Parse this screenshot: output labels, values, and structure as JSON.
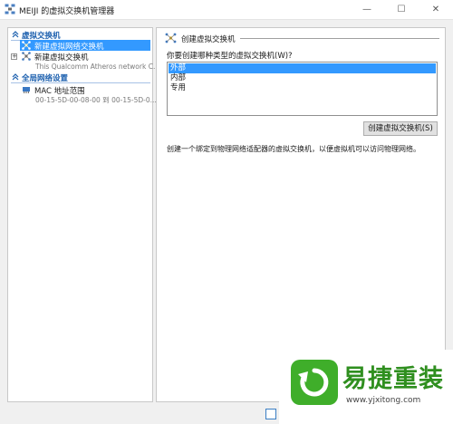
{
  "window": {
    "title": "MEIJI 的虚拟交换机管理器",
    "minimize_glyph": "—",
    "maximize_glyph": "☐",
    "close_glyph": "✕"
  },
  "left_pane": {
    "sections": [
      {
        "label": "虚拟交换机"
      },
      {
        "label": "全局网络设置"
      }
    ],
    "items": [
      {
        "label": "新建虚拟网络交换机",
        "selected": true
      },
      {
        "label": "新建虚拟交换机",
        "sub": "This Qualcomm Atheros network C...",
        "expander": "+"
      },
      {
        "label": "MAC 地址范围",
        "sub": "00-15-5D-00-08-00 到 00-15-5D-0..."
      }
    ]
  },
  "right_pane": {
    "title": "创建虚拟交换机",
    "prompt": "你要创建哪种类型的虚拟交换机(W)?",
    "switch_types": [
      {
        "label": "外部",
        "selected": true
      },
      {
        "label": "内部",
        "selected": false
      },
      {
        "label": "专用",
        "selected": false
      }
    ],
    "create_button": "创建虚拟交换机(S)",
    "description": "创建一个绑定到物理网络适配器的虚拟交换机，以便虚拟机可以访问物理网络。"
  },
  "watermark": {
    "name": "易捷重装",
    "url": "www.yjxitong.com"
  },
  "colors": {
    "selection": "#3399ff",
    "section_header": "#1b5fae",
    "watermark_green": "#2f8f1f"
  }
}
